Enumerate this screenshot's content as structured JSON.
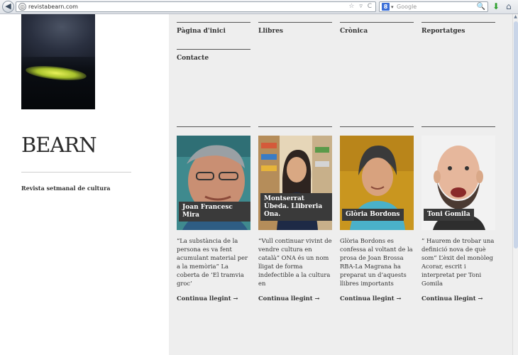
{
  "browser": {
    "url": "revistabearn.com",
    "back_glyph": "◀",
    "site_glyph": "◎",
    "url_controls": "☆ ▿ C",
    "search_engine_glyph": "8",
    "search_caret": "▾",
    "search_placeholder": "Google",
    "search_glyph": "🔍",
    "download_glyph": "⬇",
    "home_glyph": "⌂"
  },
  "site": {
    "brand": "BEARN",
    "tagline": "Revista setmanal de cultura"
  },
  "nav": [
    {
      "label": "Pàgina d'inici"
    },
    {
      "label": "Llibres"
    },
    {
      "label": "Crònica"
    },
    {
      "label": "Reportatges"
    },
    {
      "label": "Contacte"
    }
  ],
  "articles": [
    {
      "name": "Joan Francesc Mira",
      "excerpt": "“La substància de la persona es va fent acumulant material per a la memòria” La coberta de ‘El tramvia groc’",
      "more": "Continua llegint →"
    },
    {
      "name": "Montserrat Úbeda. Llibreria Ona.",
      "excerpt": "“Vull continuar vivint de vendre cultura en català” ONA és un nom lligat de forma indefectible a la cultura en",
      "more": "Continua llegint →"
    },
    {
      "name": "Glòria Bordons",
      "excerpt": "Glòria Bordons es confessa al voltant de la prosa de Joan Brossa RBA-La Magrana ha preparat un d’aquests llibres importants",
      "more": "Continua llegint →"
    },
    {
      "name": "Toni Gomila",
      "excerpt": "” Haurem de trobar una definició nova de què som”  L’èxit del monòleg Acorar, escrit i interpretat per Toni Gomila",
      "more": "Continua llegint →"
    }
  ],
  "colors": {
    "panel": "#eeeeee",
    "name_label_bg": "#3a3a3a"
  }
}
